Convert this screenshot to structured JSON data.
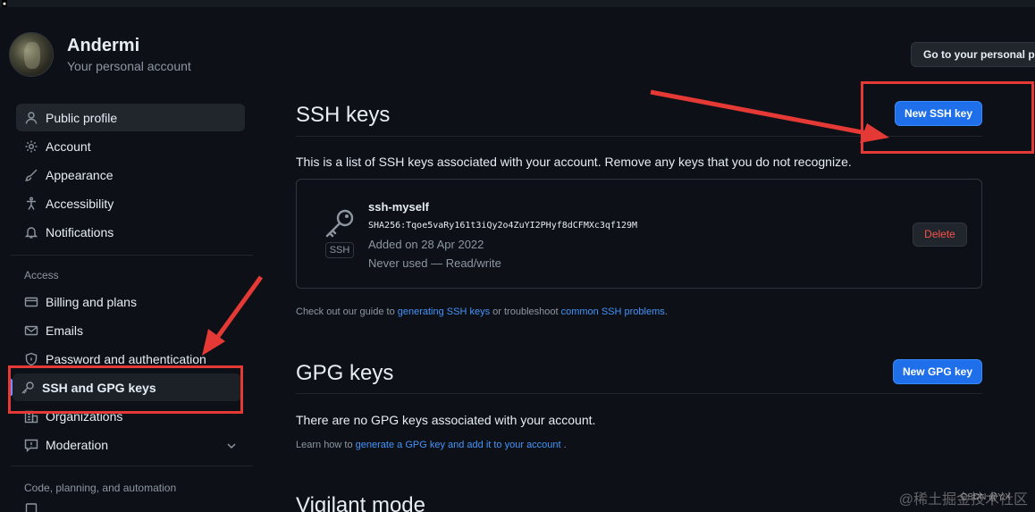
{
  "topbar": {
    "mark": "▪"
  },
  "user": {
    "name": "Andermi",
    "subtitle": "Your personal account"
  },
  "header": {
    "go_button": "Go to your personal profile"
  },
  "sidebar": {
    "items": [
      {
        "label": "Public profile",
        "icon": "person-icon"
      },
      {
        "label": "Account",
        "icon": "gear-icon"
      },
      {
        "label": "Appearance",
        "icon": "paintbrush-icon"
      },
      {
        "label": "Accessibility",
        "icon": "accessibility-icon"
      },
      {
        "label": "Notifications",
        "icon": "bell-icon"
      }
    ],
    "access_heading": "Access",
    "access_items": [
      {
        "label": "Billing and plans",
        "icon": "credit-card-icon"
      },
      {
        "label": "Emails",
        "icon": "mail-icon"
      },
      {
        "label": "Password and authentication",
        "icon": "shield-lock-icon"
      },
      {
        "label": "SSH and GPG keys",
        "icon": "key-icon"
      },
      {
        "label": "Organizations",
        "icon": "organization-icon"
      },
      {
        "label": "Moderation",
        "icon": "report-icon"
      }
    ],
    "code_heading": "Code, planning, and automation"
  },
  "ssh": {
    "title": "SSH keys",
    "new_button": "New SSH key",
    "description": "This is a list of SSH keys associated with your account. Remove any keys that you do not recognize.",
    "key": {
      "title": "ssh-myself",
      "fingerprint": "SHA256:Tqoe5vaRy161t3iQy2o4ZuYI2PHyf8dCFMXc3qf129M",
      "added": "Added on 28 Apr 2022",
      "used": "Never used — Read/write",
      "badge": "SSH",
      "delete_button": "Delete"
    },
    "guide_prefix": "Check out our guide to",
    "guide_link1": "generating SSH keys",
    "guide_middle": "or troubleshoot",
    "guide_link2": "common SSH problems",
    "guide_suffix": "."
  },
  "gpg": {
    "title": "GPG keys",
    "new_button": "New GPG key",
    "empty": "There are no GPG keys associated with your account.",
    "learn_prefix": "Learn how to",
    "learn_link": "generate a GPG key and add it to your account",
    "learn_suffix": "."
  },
  "vigilant": {
    "title": "Vigilant mode"
  },
  "watermark": {
    "site": "@稀土掘金技术社区",
    "csdn": "CSDN @Y.X"
  },
  "colors": {
    "accent": "#1f6feb",
    "danger": "#f85149",
    "annotation": "#e53935"
  }
}
